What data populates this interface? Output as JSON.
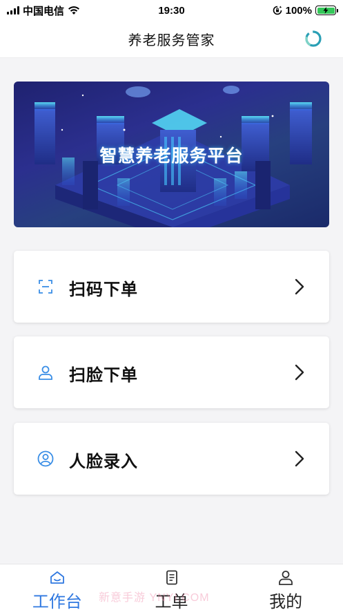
{
  "status_bar": {
    "carrier": "中国电信",
    "time": "19:30",
    "battery": "100%"
  },
  "nav": {
    "title": "养老服务管家",
    "action_icon": "loading-ring-icon"
  },
  "banner": {
    "title": "智慧养老服务平台"
  },
  "menu": [
    {
      "label": "扫码下单",
      "icon": "scan-icon"
    },
    {
      "label": "扫脸下单",
      "icon": "user-icon"
    },
    {
      "label": "人脸录入",
      "icon": "face-profile-icon"
    }
  ],
  "tab_bar": {
    "tabs": [
      {
        "label": "工作台",
        "icon": "home-icon",
        "active": true
      },
      {
        "label": "工单",
        "icon": "document-icon",
        "active": false
      },
      {
        "label": "我的",
        "icon": "profile-icon",
        "active": false
      }
    ]
  },
  "watermark": "新意手游 YNYI.COM",
  "colors": {
    "accent": "#2f78e0",
    "icon_blue": "#3a8ee6",
    "background": "#f4f4f6"
  }
}
